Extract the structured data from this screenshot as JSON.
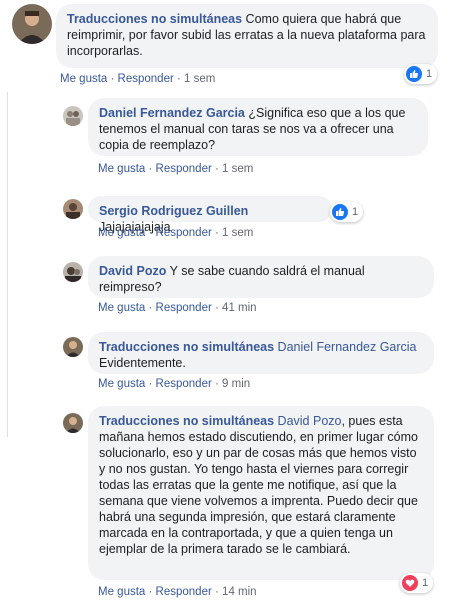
{
  "colors": {
    "link": "#385898",
    "bubble": "#f2f3f5",
    "like": "#1877f2",
    "heart": "#f33e58",
    "meta": "#606770"
  },
  "comments": [
    {
      "author": "Traducciones no simultáneas",
      "text": "Como quiera que habrá que reimprimir, por favor subid las erratas a la nueva plataforma para incorporarlas.",
      "like_label": "Me gusta",
      "reply_label": "Responder",
      "time": "1 sem",
      "reaction": {
        "icon": "like-icon",
        "count": "1"
      }
    },
    {
      "author": "Daniel Fernandez Garcia",
      "text": "¿Significa eso que a los que tenemos el manual con taras se nos va a ofrecer una copia de reemplazo?",
      "like_label": "Me gusta",
      "reply_label": "Responder",
      "time": "1 sem"
    },
    {
      "author": "Sergio Rodriguez Guillen",
      "text": "Jajajajajajaja",
      "like_label": "Me gusta",
      "reply_label": "Responder",
      "time": "1 sem",
      "reaction": {
        "icon": "like-icon",
        "count": "1"
      }
    },
    {
      "author": "David Pozo",
      "text": "Y se sabe cuando saldrá el manual reimpreso?",
      "like_label": "Me gusta",
      "reply_label": "Responder",
      "time": "41 min"
    },
    {
      "author": "Traducciones no simultáneas",
      "mention": "Daniel Fernandez Garcia",
      "text": "Evidentemente.",
      "like_label": "Me gusta",
      "reply_label": "Responder",
      "time": "9 min"
    },
    {
      "author": "Traducciones no simultáneas",
      "mention": "David Pozo",
      "text": ", pues esta mañana hemos estado discutiendo, en primer lugar cómo solucionarlo, eso y un par de cosas más que hemos visto y no nos gustan. Yo tengo hasta el viernes para corregir todas las erratas que la gente me notifique, así que la semana que viene volvemos a imprenta. Puedo decir que habrá una segunda impresión, que estará claramente marcada en la contraportada, y que a quien tenga un ejemplar de la primera tarado se le cambiará.",
      "like_label": "Me gusta",
      "reply_label": "Responder",
      "time": "14 min",
      "reaction": {
        "icon": "heart-icon",
        "count": "1"
      }
    }
  ]
}
